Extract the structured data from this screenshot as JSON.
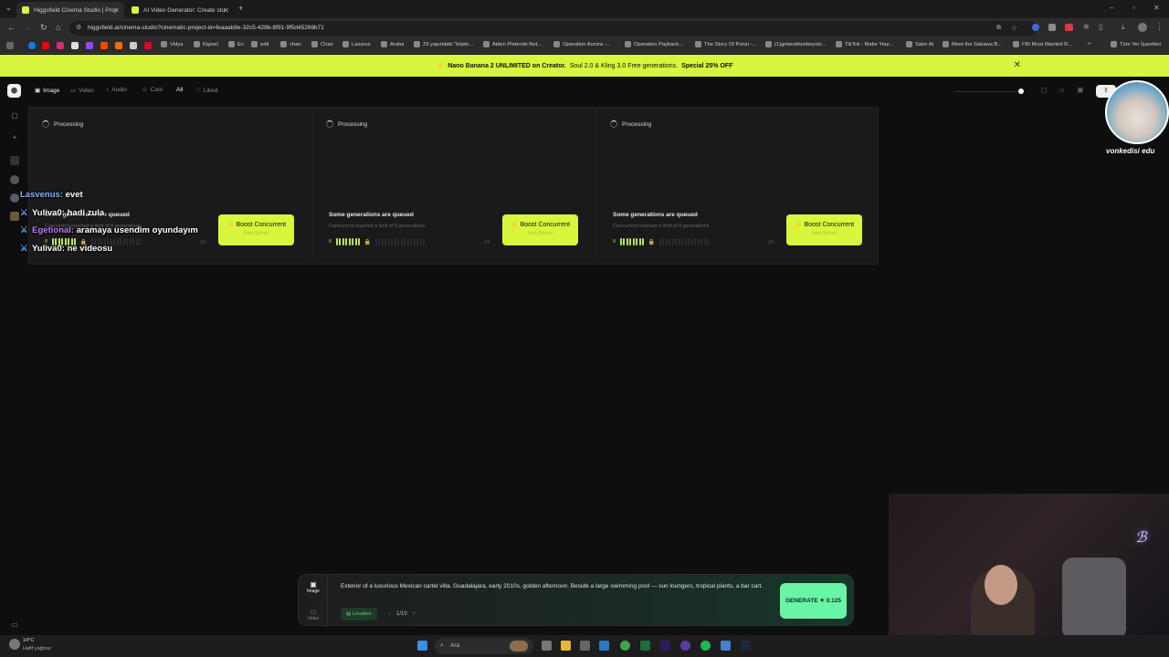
{
  "browser": {
    "tabs": [
      {
        "title": "Higgsfield Cinema Studio | Proj",
        "active": true
      },
      {
        "title": "AI Video Generator: Create stu",
        "active": false
      }
    ],
    "url": "higgsfield.ai/cinema-studio?cinematic-project-id=feaaab8e-32c5-428b-8f91-9f5d45269b71",
    "bookmarks": [
      "Vidya",
      "Kişisel",
      "Ev",
      "edit",
      "chan",
      "Chao",
      "Lazarus",
      "Araba",
      "23 yaşındaki \"kripto...",
      "Aiden Pleterski Net...",
      "Operation Aurora -...",
      "Operation Payback...",
      "The Story Of Ponzi -...",
      "(1)gelecektenbeyoic...",
      "TikTok - Make Your...",
      "Satın Al",
      "Meet the Sakawa B...",
      "FBI Most Wanted R..."
    ],
    "bookmarks_all": "Tüm Yer İşaretleri"
  },
  "promo": {
    "lead": "Nano Banana 2 UNLIMITED on Creator.",
    "middle": "Soul 2.0 & Kling 3.0 Free generations.",
    "offer": "Special 25% OFF"
  },
  "nav": {
    "items": [
      "Image",
      "Video",
      "Audio",
      "Cast",
      "All",
      "Liked"
    ]
  },
  "cards": [
    {
      "status": "Processing",
      "queue_title": "Some generations are queued",
      "queue_sub": "Concurrent reached a limit of 8 generations",
      "current": "8",
      "max": "24",
      "boost_label": "Boost Concurrent",
      "boost_price": "from $4/mo"
    },
    {
      "status": "Processing",
      "queue_title": "Some generations are queued",
      "queue_sub": "Concurrent reached a limit of 8 generations",
      "current": "8",
      "max": "24",
      "boost_label": "Boost Concurrent",
      "boost_price": "from $4/mo"
    },
    {
      "status": "Processing",
      "queue_title": "Some generations are queued",
      "queue_sub": "Concurrent reached a limit of 8 generations",
      "current": "8",
      "max": "24",
      "boost_label": "Boost Concurrent",
      "boost_price": "from $4/mo"
    }
  ],
  "chat": [
    {
      "user": "Lasvenus:",
      "msg": "evet",
      "color": "#7fb3ff",
      "pin": false
    },
    {
      "user": "Yuliva0:",
      "msg": "hadi zula",
      "color": "#ffffff",
      "pin": true
    },
    {
      "user": "Egetional:",
      "msg": "aramaya usendim oyundayım",
      "color": "#c07bff",
      "pin": true
    },
    {
      "user": "Yuliva0:",
      "msg": "ne videosu",
      "color": "#ffffff",
      "pin": true
    }
  ],
  "prompt": {
    "modes": [
      "Image",
      "Video"
    ],
    "text": "Exterior of a luxurious Mexican cartel villa. Guadalajara, early 2010s, golden afternoon. Beside a large swimming pool — sun loungers, tropical plants, a bar cart.",
    "location_label": "Location",
    "count": "1/10",
    "generate_label": "GENERATE",
    "generate_cost": "0.125"
  },
  "taskbar": {
    "weather_temp": "14°C",
    "weather_desc": "Hafif yağmur",
    "search": "Ara"
  },
  "stream": {
    "avatar_name": "vonkedisi edu"
  }
}
